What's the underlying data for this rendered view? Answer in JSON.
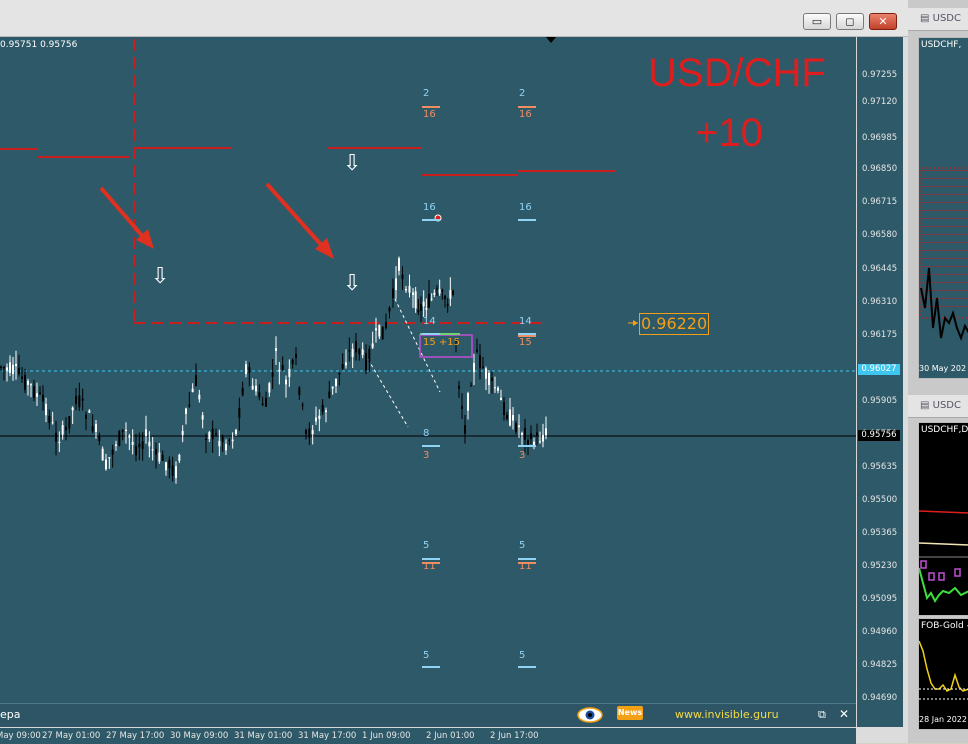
{
  "window": {
    "controls": {
      "minimize_glyph": "▭",
      "maximize_glyph": "◻",
      "close_glyph": "✕"
    }
  },
  "chart": {
    "header_prices": "0.95751 0.95756",
    "symbol_overlay": "USD/CHF",
    "profit_overlay": "+10",
    "target_price": "0.96220",
    "zone_label": "15 +15",
    "level_labels": {
      "c1": [
        "2",
        "16",
        "16",
        "14",
        "15",
        "8",
        "3",
        "5",
        "11",
        "5"
      ],
      "c2": [
        "2",
        "16",
        "16",
        "14",
        "15",
        "3",
        "5",
        "11",
        "5"
      ]
    },
    "colors": {
      "background": "#2e5968",
      "bull_candle": "#ffffff",
      "bear_candle": "#000000",
      "accent_red": "#e01d1d",
      "accent_orange": "#f3a015",
      "zone_purple": "#c04ed6",
      "level_blue": "#8fd3f5",
      "level_orange": "#f08d62"
    },
    "icons": {
      "arrow_down": "⇩",
      "eye": "eye-icon",
      "news": "news-icon"
    }
  },
  "price_axis": {
    "labels": [
      "0.97255",
      "0.97120",
      "0.96985",
      "0.96850",
      "0.96715",
      "0.96580",
      "0.96445",
      "0.96310",
      "0.96175",
      "0.95905",
      "0.95770",
      "0.95635",
      "0.95500",
      "0.95365",
      "0.95230",
      "0.95095",
      "0.94960",
      "0.94825",
      "0.94690"
    ],
    "current_bid": "0.95756",
    "highlight": "0.96027"
  },
  "time_axis": {
    "labels": [
      "May 09:00",
      "27 May 01:00",
      "27 May 17:00",
      "30 May 09:00",
      "31 May 01:00",
      "31 May 17:00",
      "1 Jun 09:00",
      "2 Jun 01:00",
      "2 Jun 17:00"
    ]
  },
  "status_bar": {
    "left_text": "epa",
    "news_label": "News",
    "site_url": "www.invisible.guru",
    "restore_glyph": "⧉",
    "close_glyph": "✕"
  },
  "side_panels": {
    "panel1_title": "USDC",
    "panel1_subtitle": "USDCHF,",
    "panel1_date": "30 May 202",
    "panel2_title": "USDC",
    "panel2_subtitle": "USDCHF,D",
    "panel3_subtitle": "FOB-Gold -",
    "panel3_date": "28 Jan 2022"
  }
}
